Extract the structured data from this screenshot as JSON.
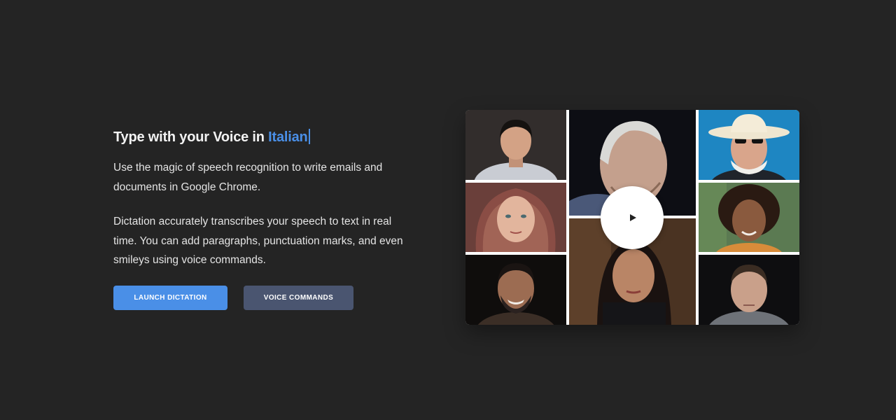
{
  "hero": {
    "headline_prefix": "Type with your Voice in ",
    "headline_language": "Italian",
    "paragraph_1": "Use the magic of speech recognition to write emails and documents in Google Chrome.",
    "paragraph_2": "Dictation accurately transcribes your speech to text in real time. You can add paragraphs, punctuation marks, and even smileys using voice commands."
  },
  "buttons": {
    "launch_label": "LAUNCH DICTATION",
    "voice_commands_label": "VOICE COMMANDS"
  },
  "video": {
    "play_icon": "play-icon"
  },
  "colors": {
    "background": "#242424",
    "accent": "#4a8fe7",
    "secondary_button": "#4a5570"
  }
}
